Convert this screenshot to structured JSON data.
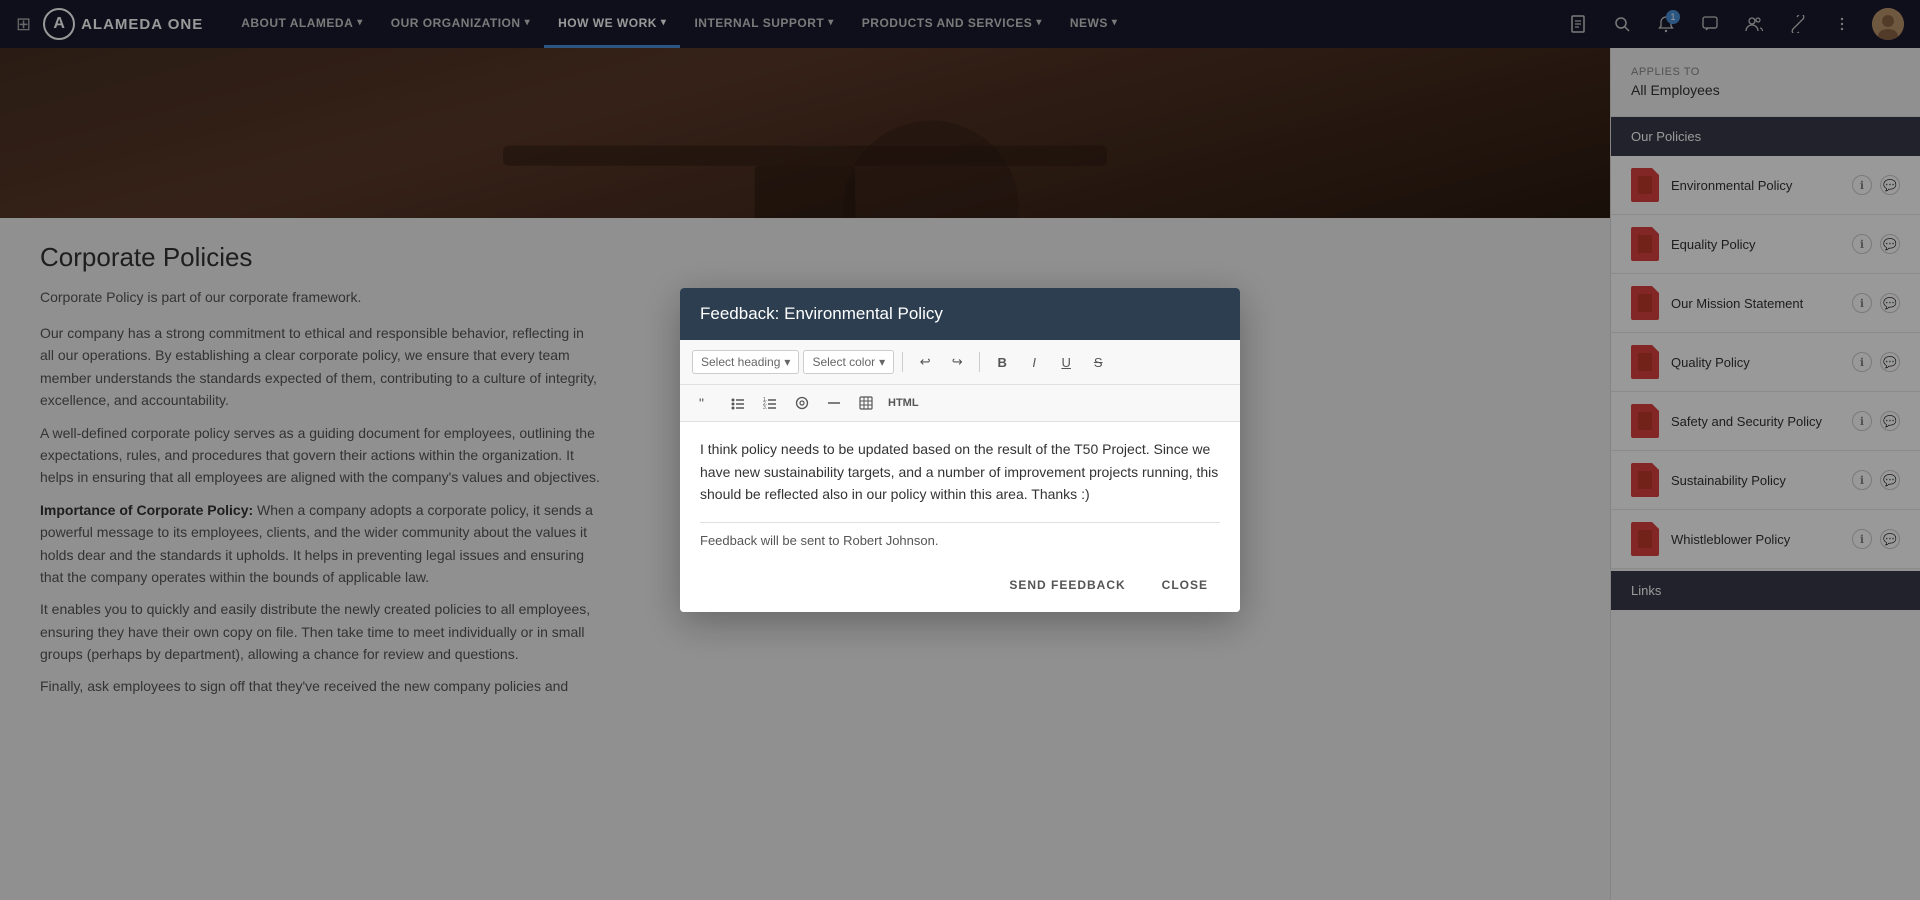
{
  "app": {
    "logo_symbol": "A",
    "logo_name": "ALAMEDA ONE"
  },
  "nav": {
    "items": [
      {
        "label": "ABOUT ALAMEDA",
        "has_arrow": true,
        "active": false
      },
      {
        "label": "OUR ORGANIZATION",
        "has_arrow": true,
        "active": false
      },
      {
        "label": "HOW WE WORK",
        "has_arrow": true,
        "active": true
      },
      {
        "label": "INTERNAL SUPPORT",
        "has_arrow": true,
        "active": false
      },
      {
        "label": "PRODUCTS AND SERVICES",
        "has_arrow": true,
        "active": false
      },
      {
        "label": "NEWS",
        "has_arrow": true,
        "active": false
      }
    ]
  },
  "notification_count": "1",
  "sidebar": {
    "applies_label": "Applies to",
    "applies_value": "All Employees",
    "policies_title": "Our Policies",
    "policies": [
      {
        "label": "Environmental Policy"
      },
      {
        "label": "Equality Policy"
      },
      {
        "label": "Our Mission Statement"
      },
      {
        "label": "Quality Policy"
      },
      {
        "label": "Safety and Security Policy"
      },
      {
        "label": "Sustainability Policy"
      },
      {
        "label": "Whistleblower Policy"
      }
    ],
    "links_title": "Links"
  },
  "page": {
    "title": "Corporate Policies",
    "subtitle": "Corporate Policy is part of our corporate framework.",
    "body1": "Our company has a strong commitment to ethical and responsible behavior, reflecting in all our operations. By establishing a clear corporate policy, we ensure that every team member understands the standards expected of them, contributing to a culture of integrity, excellence, and accountability.",
    "body2": "A well-defined corporate policy serves as a guiding document for employees, outlining the expectations, rules, and procedures that govern their actions within the organization. It helps in ensuring that all employees are aligned with the company's values and objectives.",
    "body3_label": "Importance of Corporate Policy:",
    "body3": "When a company adopts a corporate policy, it sends a powerful message to its employees, clients, and the wider community about the values it holds dear and the standards it upholds. It helps in preventing legal issues and ensuring that the company operates within the bounds of applicable law.",
    "body4": "It enables you to quickly and easily distribute the newly created policies to all employees, ensuring they have their own copy on file. Then take time to meet individually or in small groups (perhaps by department), allowing a chance for review and questions.",
    "body5": "Finally, ask employees to sign off that they've received the new company policies and"
  },
  "modal": {
    "title": "Feedback: Environmental Policy",
    "toolbar": {
      "select_heading": "Select heading",
      "select_color": "Select color",
      "undo_icon": "↩",
      "redo_icon": "↪",
      "bold_icon": "B",
      "italic_icon": "I",
      "underline_icon": "U",
      "strikethrough_icon": "S̶",
      "quote_icon": "\"",
      "bullet_icon": "•",
      "numbered_icon": "#",
      "embed_icon": "⊙",
      "hr_icon": "—",
      "table_icon": "⊞",
      "html_label": "HTML"
    },
    "content": "I think policy needs to be updated based on the result of the T50 Project. Since we have new sustainability targets, and a number of improvement projects running, this should be reflected also in our policy within this area. Thanks :)",
    "feedback_note": "Feedback will be sent to Robert Johnson.",
    "send_label": "SEND FEEDBACK",
    "close_label": "CLOSE"
  }
}
